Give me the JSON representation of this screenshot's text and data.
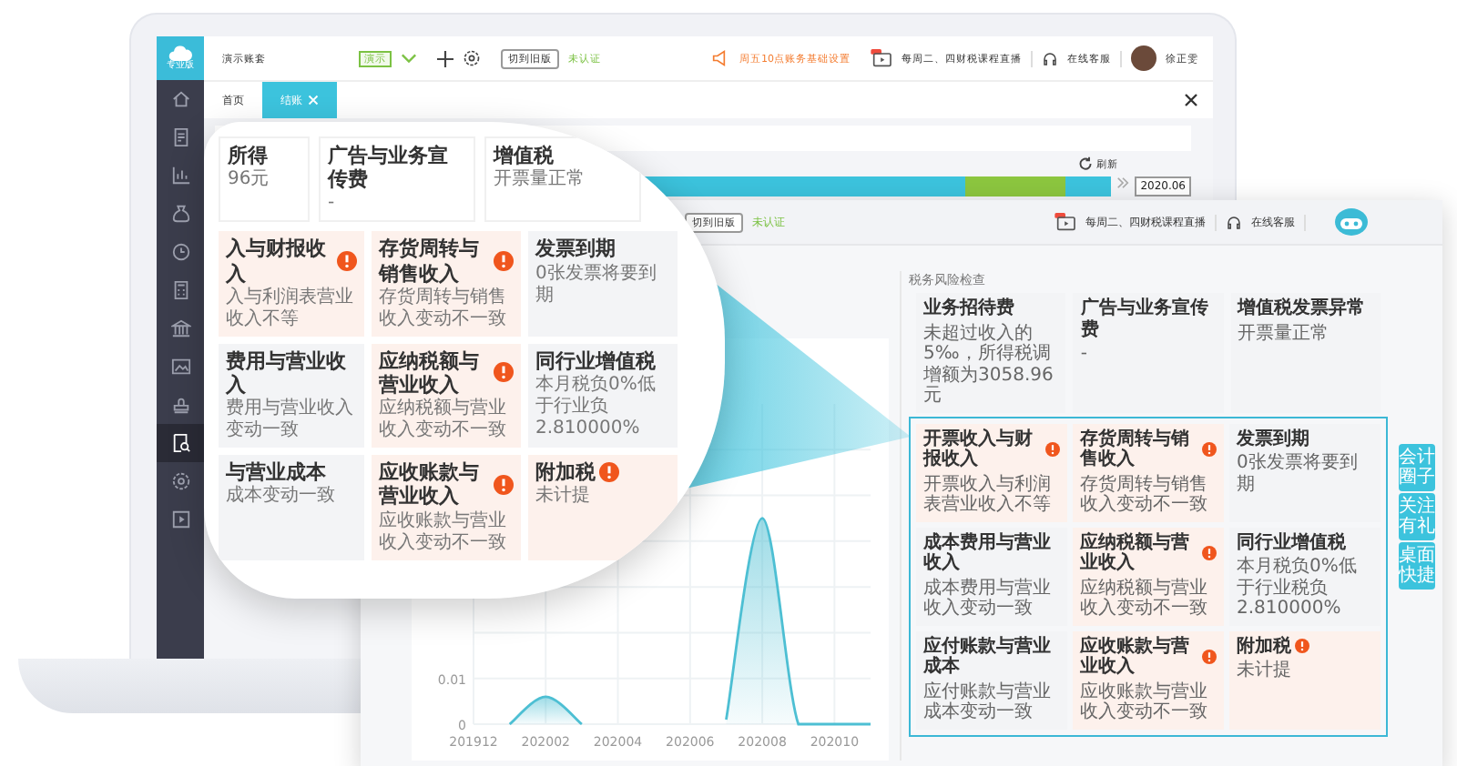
{
  "logo": {
    "label": "专业版"
  },
  "sidebar": {
    "items": [
      {
        "kind": "home",
        "selected": false
      },
      {
        "kind": "document",
        "selected": false
      },
      {
        "kind": "chart",
        "selected": false
      },
      {
        "kind": "bag",
        "selected": false
      },
      {
        "kind": "clock",
        "selected": false
      },
      {
        "kind": "calculator",
        "selected": false
      },
      {
        "kind": "bank",
        "selected": false
      },
      {
        "kind": "image",
        "selected": false
      },
      {
        "kind": "stamp",
        "selected": false
      },
      {
        "kind": "search",
        "selected": true
      },
      {
        "kind": "settings",
        "selected": false
      },
      {
        "kind": "play",
        "selected": false
      }
    ]
  },
  "topbar": {
    "account": "演示账套",
    "account_badge": "演示",
    "switch_button": "切到旧版",
    "auth_status": "未认证",
    "notice": "周五10点账务基础设置",
    "live": "每周二、四财税课程直播",
    "service": "在线客服",
    "user": "徐正雯"
  },
  "tabs": [
    {
      "label": "首页",
      "selected": false,
      "closable": false
    },
    {
      "label": "结账",
      "selected": true,
      "closable": true
    }
  ],
  "refresh": "刷新",
  "date": "2020.06",
  "magnifier": {
    "top_cards": [
      {
        "title": "所得",
        "desc": "96元"
      },
      {
        "title": "广告与业务宣传费",
        "desc": "-"
      },
      {
        "title": "增值税",
        "desc": "开票量正常"
      }
    ],
    "cards": [
      {
        "title": "入与财报收入",
        "alert": true,
        "desc": "入与利润表营业收入不等"
      },
      {
        "title": "存货周转与销售收入",
        "alert": true,
        "desc": "存货周转与销售收入变动不一致"
      },
      {
        "title": "发票到期",
        "alert": false,
        "desc": "0张发票将要到期"
      },
      {
        "title": "费用与营业收入",
        "alert": false,
        "desc": "费用与营业收入变动一致"
      },
      {
        "title": "应纳税额与营业收入",
        "alert": true,
        "desc": "应纳税额与营业收入变动不一致"
      },
      {
        "title": "同行业增值税",
        "alert": false,
        "desc": "本月税负0%低于行业负2.810000%"
      },
      {
        "title": "与营业成本",
        "alert": false,
        "desc": "成本变动一致"
      },
      {
        "title": "应收账款与营业收入",
        "alert": true,
        "desc": "应收账款与营业收入变动不一致"
      },
      {
        "title": "附加税",
        "alert": true,
        "desc": "未计提"
      }
    ]
  },
  "window2": {
    "switch_button": "切到旧版",
    "auth_status": "未认证",
    "live": "每周二、四财税课程直播",
    "service": "在线客服",
    "chart_data": {
      "type": "area",
      "categories": [
        "201912",
        null,
        "202002",
        null,
        "202004",
        null,
        "202006",
        null,
        "202008",
        null,
        "202010",
        null
      ],
      "series": [
        {
          "color": "#4dbfd3",
          "values": [
            null,
            0,
            0.006,
            0,
            null,
            null,
            null,
            0.001,
            0.045,
            0,
            0,
            0
          ]
        }
      ],
      "yticks": [
        0,
        0.01
      ],
      "ylim": [
        0,
        0.07
      ],
      "grid": true
    },
    "section_title": "税务风险检查",
    "top_cards": [
      {
        "title": "业务招待费",
        "desc": "未超过收入的5‰，所得税调增额为3058.96元"
      },
      {
        "title": "广告与业务宣传费",
        "desc": "-"
      },
      {
        "title": "增值税发票异常",
        "desc": "开票量正常"
      }
    ],
    "cards": [
      {
        "title": "开票收入与财报收入",
        "alert": true,
        "desc": "开票收入与利润表营业收入不等"
      },
      {
        "title": "存货周转与销售收入",
        "alert": true,
        "desc": "存货周转与销售收入变动不一致"
      },
      {
        "title": "发票到期",
        "alert": false,
        "desc": "0张发票将要到期"
      },
      {
        "title": "成本费用与营业收入",
        "alert": false,
        "desc": "成本费用与营业收入变动一致"
      },
      {
        "title": "应纳税额与营业收入",
        "alert": true,
        "desc": "应纳税额与营业收入变动不一致"
      },
      {
        "title": "同行业增值税",
        "alert": false,
        "desc": "本月税负0%低于行业税负2.810000%"
      },
      {
        "title": "应付账款与营业成本",
        "alert": false,
        "desc": "应付账款与营业成本变动一致"
      },
      {
        "title": "应收账款与营业收入",
        "alert": true,
        "desc": "应收账款与营业收入变动不一致"
      },
      {
        "title": "附加税",
        "alert": true,
        "desc": "未计提"
      }
    ],
    "side_tabs": [
      "会计圈子",
      "关注有礼",
      "桌面快捷"
    ]
  }
}
